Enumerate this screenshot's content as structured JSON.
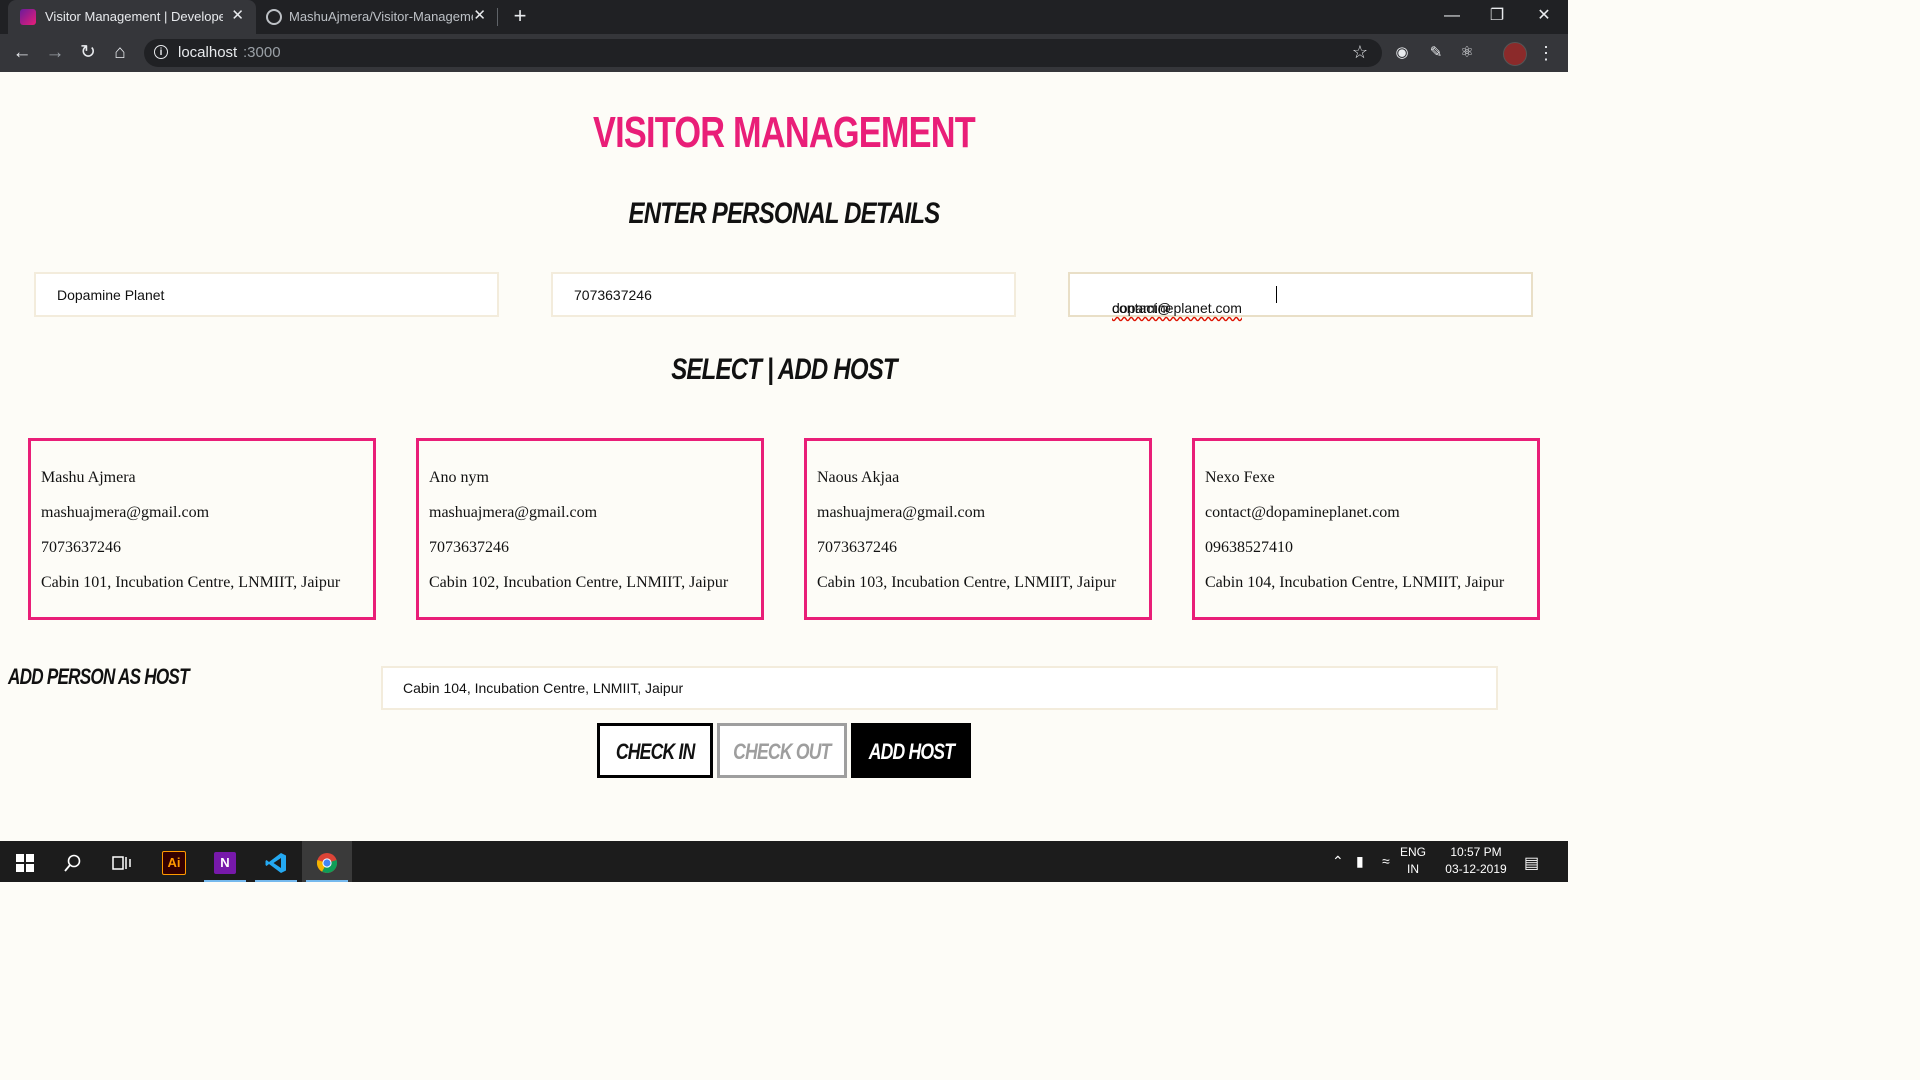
{
  "browser": {
    "tabs": [
      {
        "title": "Visitor Management | Developed",
        "close": "✕"
      },
      {
        "title": "MashuAjmera/Visitor-Manageme",
        "close": "✕"
      }
    ],
    "new_tab": "+",
    "url_host": "localhost",
    "url_port": ":3000",
    "window_controls": {
      "minimize": "—",
      "maximize": "❐",
      "close": "✕"
    },
    "icons": [
      "back-icon",
      "forward-icon",
      "reload-icon",
      "home-icon",
      "info-icon",
      "star-icon",
      "camera-icon",
      "pen-icon",
      "react-icon",
      "profile-avatar",
      "menu-dots-icon"
    ]
  },
  "page": {
    "title": "VISITOR MANAGEMENT",
    "personal_heading": "ENTER PERSONAL DETAILS",
    "fields": {
      "name": "Dopamine Planet",
      "phone": "7073637246",
      "email_prefix": "contact@",
      "email_misspelled": "dopamineplanet.com"
    },
    "host_heading": "SELECT | ADD HOST",
    "hosts": [
      {
        "name": "Mashu Ajmera",
        "email": "mashuajmera@gmail.com",
        "phone": "7073637246",
        "address": "Cabin 101, Incubation Centre, LNMIIT, Jaipur"
      },
      {
        "name": "Ano nym",
        "email": "mashuajmera@gmail.com",
        "phone": "7073637246",
        "address": "Cabin 102, Incubation Centre, LNMIIT, Jaipur"
      },
      {
        "name": "Naous Akjaa",
        "email": "mashuajmera@gmail.com",
        "phone": "7073637246",
        "address": "Cabin 103, Incubation Centre, LNMIIT, Jaipur"
      },
      {
        "name": "Nexo Fexe",
        "email": "contact@dopamineplanet.com",
        "phone": "09638527410",
        "address": "Cabin 104, Incubation Centre, LNMIIT, Jaipur"
      }
    ],
    "add_host_label": "ADD PERSON AS HOST",
    "host_address_value": "Cabin 104, Incubation Centre, LNMIIT, Jaipur",
    "buttons": {
      "check_in": "CHECK IN",
      "check_out": "CHECK OUT",
      "add_host": "ADD HOST"
    },
    "colors": {
      "accent": "#e91e78",
      "background": "#fdfcf7",
      "disabled": "#9e9e9e"
    }
  },
  "taskbar": {
    "apps": [
      "windows-start-icon",
      "search-icon",
      "task-view-icon",
      "illustrator-icon",
      "onenote-icon",
      "vscode-icon",
      "chrome-icon"
    ],
    "illustrator_label": "Ai",
    "onenote_label": "N",
    "lang_top": "ENG",
    "lang_bottom": "IN",
    "time": "10:57 PM",
    "date": "03-12-2019"
  }
}
